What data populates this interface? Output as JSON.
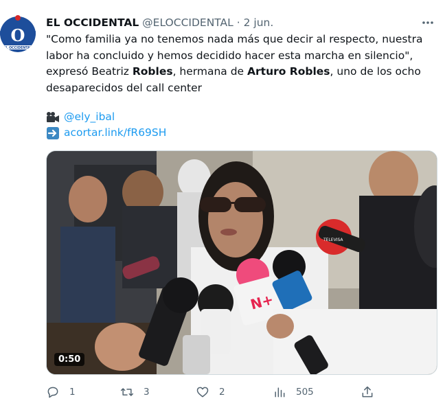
{
  "author": {
    "display_name": "EL OCCIDENTAL",
    "handle": "@ELOCCIDENTAL",
    "separator": "·",
    "date": "2 jun.",
    "avatar_letter": "O",
    "avatar_caption": "EL OCCIDENTAL"
  },
  "tweet": {
    "text_part1": "\"Como familia ya no tenemos nada más que decir al respecto, nuestra labor ha concluido y hemos decidido hacer esta marcha en silencio\", expresó Beatriz ",
    "bold1": "Robles",
    "text_part2": ", hermana de ",
    "bold2": "Arturo Robles",
    "text_part3": ", uno de los ocho desaparecidos del call center",
    "credit_link": "@ely_ibal",
    "short_link": "acortar.link/fR69SH"
  },
  "media": {
    "duration": "0:50",
    "mic_labels": [
      "N+",
      "TELEVISA"
    ]
  },
  "actions": {
    "reply_count": "1",
    "retweet_count": "3",
    "like_count": "2",
    "view_count": "505"
  },
  "icons": {
    "avatar": "newspaper-logo-icon",
    "more": "more-icon",
    "camera": "video-camera-icon",
    "arrow": "right-arrow-icon",
    "reply": "reply-icon",
    "retweet": "retweet-icon",
    "like": "heart-icon",
    "views": "views-icon",
    "share": "share-icon"
  },
  "colors": {
    "accent": "#1d9bf0",
    "muted": "#536471",
    "avatar_blue": "#1d4e9b",
    "avatar_red": "#d62828"
  }
}
